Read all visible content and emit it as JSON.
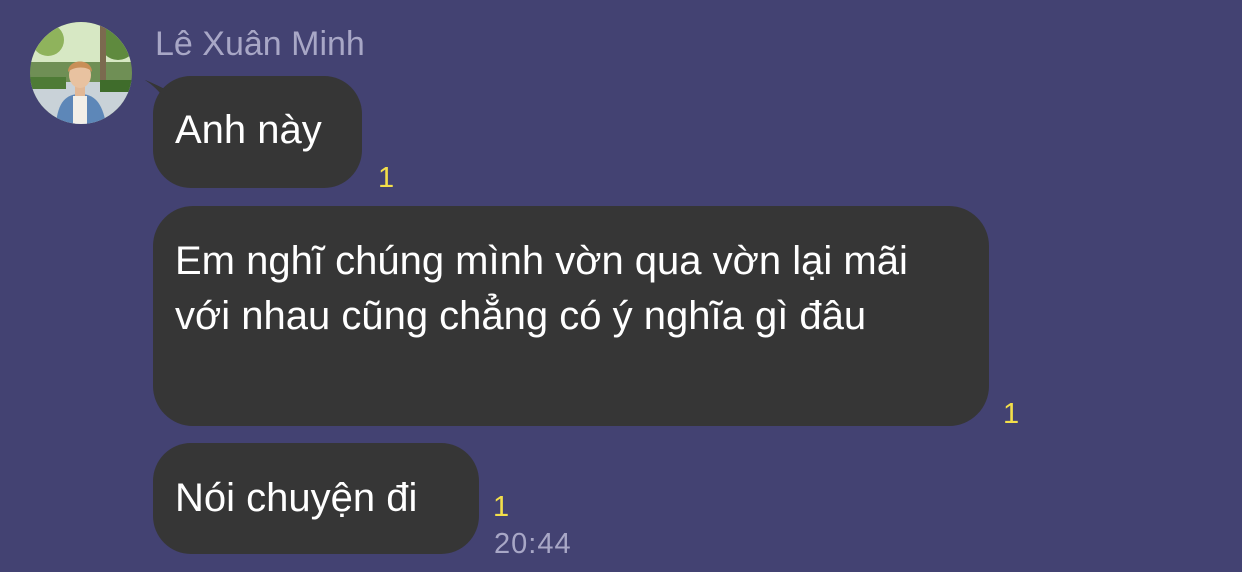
{
  "chat": {
    "sender_name": "Lê Xuân Minh",
    "avatar": "profile-photo",
    "messages": [
      {
        "text": "Anh này",
        "read_label": "1"
      },
      {
        "text": "Em nghĩ chúng mình vờn qua vờn lại mãi với nhau cũng chẳng có ý nghĩa gì đâu",
        "read_label": "1"
      },
      {
        "text": "Nói chuyện đi",
        "read_label": "1",
        "time": "20:44"
      }
    ]
  },
  "colors": {
    "background": "#434272",
    "bubble": "#363636",
    "read_indicator": "#f3df4a",
    "muted_text": "#a8a7c6"
  }
}
